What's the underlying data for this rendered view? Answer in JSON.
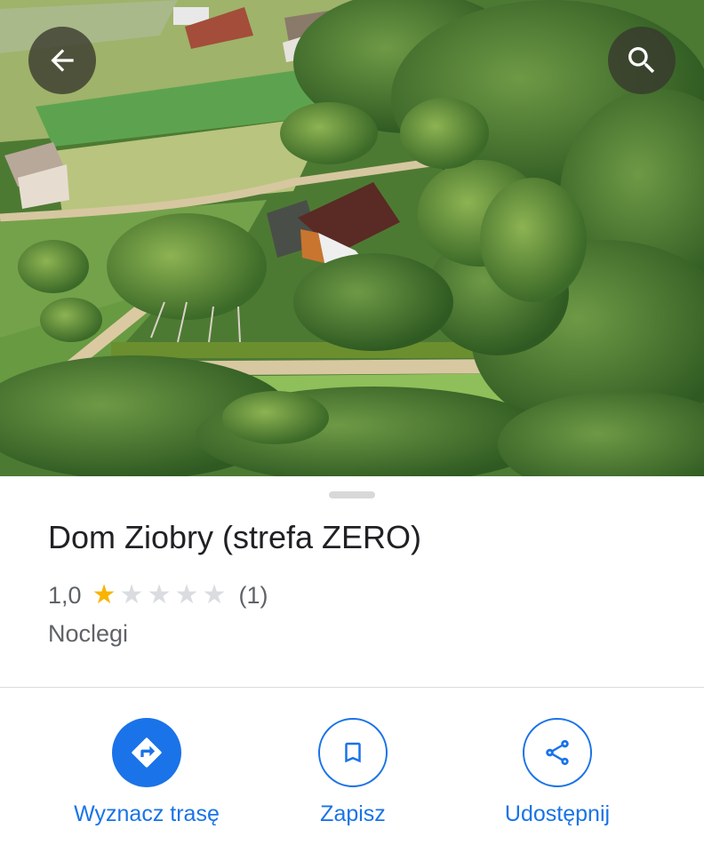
{
  "photo": {
    "description_icon": "aerial-photo"
  },
  "toolbar": {
    "back_icon": "arrow-back-icon",
    "search_icon": "search-icon"
  },
  "place": {
    "name": "Dom Ziobry (strefa ZERO)",
    "rating": "1,0",
    "rating_stars": 1,
    "max_stars": 5,
    "review_count": "(1)",
    "category": "Noclegi"
  },
  "actions": [
    {
      "label": "Wyznacz trasę",
      "icon": "directions-icon"
    },
    {
      "label": "Zapisz",
      "icon": "bookmark-icon"
    },
    {
      "label": "Udostępnij",
      "icon": "share-icon"
    }
  ],
  "colors": {
    "accent": "#1a73e8",
    "star": "#f8b400",
    "star_empty": "#dadce0",
    "text_primary": "#202124",
    "text_secondary": "#5f6368"
  }
}
